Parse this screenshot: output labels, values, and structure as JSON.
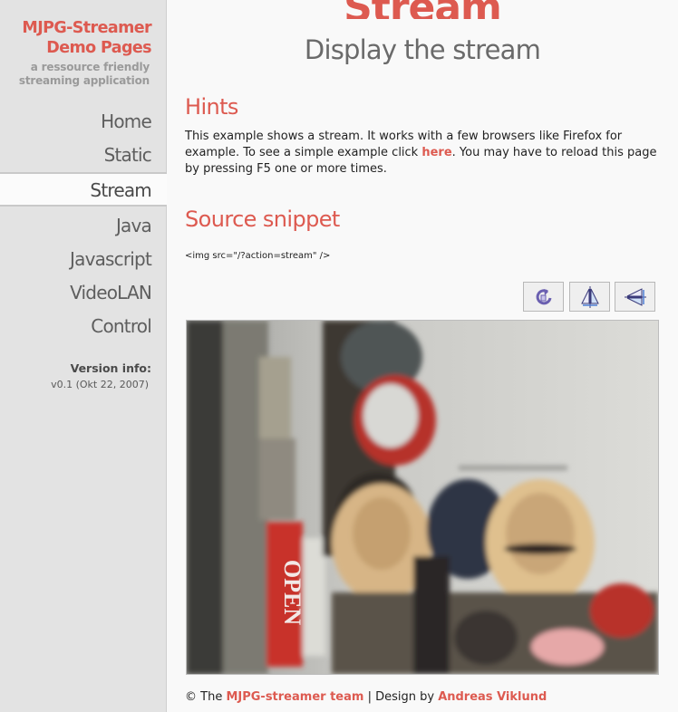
{
  "sidebar": {
    "title_line1": "MJPG-Streamer",
    "title_line2": "Demo Pages",
    "subtitle_line1": "a ressource friendly",
    "subtitle_line2": "streaming application",
    "nav": [
      {
        "label": "Home"
      },
      {
        "label": "Static"
      },
      {
        "label": "Stream",
        "active": true
      },
      {
        "label": "Java"
      },
      {
        "label": "Javascript"
      },
      {
        "label": "VideoLAN"
      },
      {
        "label": "Control"
      }
    ],
    "version_label": "Version info:",
    "version_value": "v0.1 (Okt 22, 2007)"
  },
  "main": {
    "heading": "Stream",
    "subheading": "Display the stream",
    "hints": {
      "title": "Hints",
      "text_before": "This example shows a stream. It works with a few browsers like Firefox for example. To see a simple example click ",
      "link": "here",
      "text_after": ". You may have to reload this page by pressing F5 one or more times."
    },
    "snippet": {
      "title": "Source snippet",
      "code": "<img src=\"/?action=stream\" />"
    },
    "toolbar": [
      {
        "icon": "rotate-icon"
      },
      {
        "icon": "flip-vertical-icon"
      },
      {
        "icon": "flip-horizontal-icon"
      }
    ],
    "stream_sign_text": "OPEN"
  },
  "footer": {
    "copyright": "© The ",
    "team_link": "MJPG-streamer team",
    "separator": " | Design by ",
    "designer_link": "Andreas Viklund"
  },
  "colors": {
    "accent": "#dd5a50",
    "sidebar_bg": "#e3e3e3",
    "page_bg": "#f9f9f9"
  }
}
